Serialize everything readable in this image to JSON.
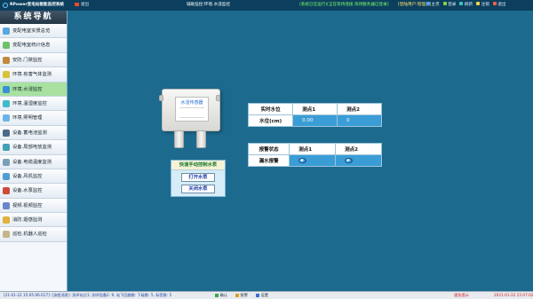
{
  "app": {
    "title": "RPower变电站智能监控系统",
    "back_label": "退出",
    "breadcrumb": "辅助监控:环境.水浸监控",
    "status_message": "(系统已在运行)[正在等待连接,等待服务器已登录]",
    "user_info": "[登陆用户:管理员]",
    "actions": [
      {
        "label": "主页",
        "icon": "home-icon",
        "color": "#4fa3ff"
      },
      {
        "label": "登录",
        "icon": "login-icon",
        "color": "#8ad04b"
      },
      {
        "label": "刷新",
        "icon": "refresh-icon",
        "color": "#36c6c0"
      },
      {
        "label": "注销",
        "icon": "logout-icon",
        "color": "#ffd34a"
      },
      {
        "label": "退出",
        "icon": "exit-icon",
        "color": "#ff5a4a"
      }
    ]
  },
  "sidebar": {
    "title": "系统导航",
    "items": [
      {
        "label": "变配电室实景总览",
        "icon": "overview-icon",
        "color": "#5aa6e0"
      },
      {
        "label": "变配电室统计信息",
        "icon": "stats-icon",
        "color": "#6cc26a"
      },
      {
        "label": "安防.门禁监控",
        "icon": "door-icon",
        "color": "#c08a3e"
      },
      {
        "label": "环境.有害气体监测",
        "icon": "gas-icon",
        "color": "#d7c23c"
      },
      {
        "label": "环境.水浸监控",
        "icon": "water-icon",
        "color": "#3a8fd6"
      },
      {
        "label": "环境.温湿度监控",
        "icon": "thermometer-icon",
        "color": "#3fbac9"
      },
      {
        "label": "环境.照明管理",
        "icon": "light-icon",
        "color": "#6bb4e8"
      },
      {
        "label": "设备.蓄电池监测",
        "icon": "battery-icon",
        "color": "#4c6a8a"
      },
      {
        "label": "设备.局部电放监测",
        "icon": "discharge-icon",
        "color": "#3fa0b6"
      },
      {
        "label": "设备.电缆温度监测",
        "icon": "cable-temp-icon",
        "color": "#7aa0b8"
      },
      {
        "label": "设备.风机监控",
        "icon": "fan-icon",
        "color": "#4f9ed0"
      },
      {
        "label": "设备.水泵监控",
        "icon": "pump-icon",
        "color": "#d04a3a"
      },
      {
        "label": "视频.视频监控",
        "icon": "camera-icon",
        "color": "#6b86c8"
      },
      {
        "label": "消防.烟感监测",
        "icon": "smoke-icon",
        "color": "#e0b23a"
      },
      {
        "label": "巡检.机器人巡检",
        "icon": "robot-icon",
        "color": "#c6b48a"
      }
    ],
    "active_index": 4
  },
  "device": {
    "label": "水浸传感器"
  },
  "pump_panel": {
    "title": "快速手动控制水泵",
    "open_label": "打开水泵",
    "close_label": "关闭水泵"
  },
  "level_table": {
    "headers": [
      "实时水位",
      "测点1",
      "测点2"
    ],
    "row_label": "水位(cm)",
    "values": [
      "0.00",
      "0"
    ]
  },
  "leak_table": {
    "headers": [
      "报警状态",
      "测点1",
      "测点2"
    ],
    "row_label": "漏水报警"
  },
  "statusbar": {
    "log": "[21-01-22 15:05:06.617]: [流程消息]: 测评站点1; 测评设备1: 9, 站下回路数: 下级数: 5, 标签数: 5",
    "buttons": [
      {
        "label": "确认",
        "icon": "confirm-icon",
        "color": "#3aa84a"
      },
      {
        "label": "报警",
        "icon": "alarm-icon",
        "color": "#e0a020"
      },
      {
        "label": "设置",
        "icon": "settings-icon",
        "color": "#3a6fd0"
      }
    ],
    "alarm_text": "遇急提示",
    "clock": "2021-01-22 15:07:02"
  }
}
